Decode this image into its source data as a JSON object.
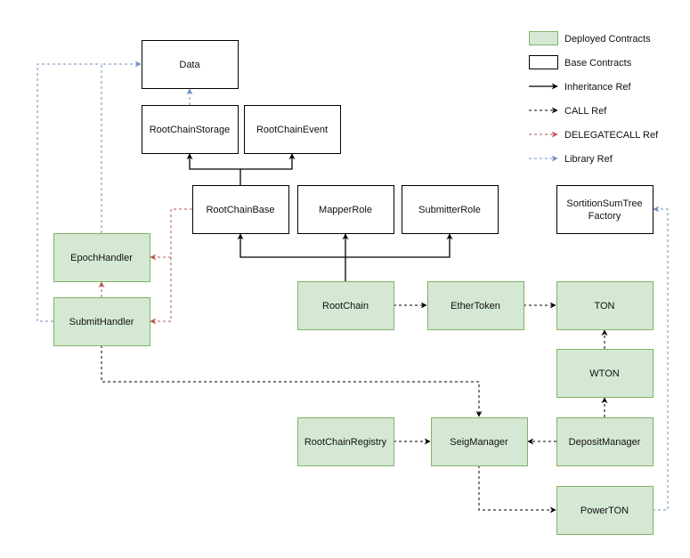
{
  "colors": {
    "deployed_fill": "#d5e8d4",
    "deployed_stroke": "#82b366",
    "base_fill": "#ffffff",
    "base_stroke": "#000000",
    "inheritance": "#000000",
    "call": "#000000",
    "delegatecall": "#b85450",
    "library": "#6c8ebf"
  },
  "legend": {
    "items": [
      {
        "kind": "deployed",
        "label": "Deployed Contracts"
      },
      {
        "kind": "base",
        "label": "Base Contracts"
      },
      {
        "kind": "inheritance",
        "label": "Inheritance Ref"
      },
      {
        "kind": "call",
        "label": "CALL Ref"
      },
      {
        "kind": "delegatecall",
        "label": "DELEGATECALL Ref"
      },
      {
        "kind": "library",
        "label": "Library Ref"
      }
    ]
  },
  "nodes": [
    {
      "id": "data",
      "lines": [
        "Data"
      ],
      "type": "base"
    },
    {
      "id": "rootchain-storage",
      "lines": [
        "RootChainStorage"
      ],
      "type": "base"
    },
    {
      "id": "rootchain-event",
      "lines": [
        "RootChainEvent"
      ],
      "type": "base"
    },
    {
      "id": "rootchain-base",
      "lines": [
        "RootChainBase"
      ],
      "type": "base"
    },
    {
      "id": "mapper-role",
      "lines": [
        "MapperRole"
      ],
      "type": "base"
    },
    {
      "id": "submitter-role",
      "lines": [
        "SubmitterRole"
      ],
      "type": "base"
    },
    {
      "id": "sortition-sum-tree-factory",
      "lines": [
        "SortitionSumTree",
        "Factory"
      ],
      "type": "base"
    },
    {
      "id": "epoch-handler",
      "lines": [
        "EpochHandler"
      ],
      "type": "deployed"
    },
    {
      "id": "submit-handler",
      "lines": [
        "SubmitHandler"
      ],
      "type": "deployed"
    },
    {
      "id": "rootchain",
      "lines": [
        "RootChain"
      ],
      "type": "deployed"
    },
    {
      "id": "ether-token",
      "lines": [
        "EtherToken"
      ],
      "type": "deployed"
    },
    {
      "id": "ton",
      "lines": [
        "TON"
      ],
      "type": "deployed"
    },
    {
      "id": "wton",
      "lines": [
        "WTON"
      ],
      "type": "deployed"
    },
    {
      "id": "rootchain-registry",
      "lines": [
        "RootChainRegistry"
      ],
      "type": "deployed"
    },
    {
      "id": "seig-manager",
      "lines": [
        "SeigManager"
      ],
      "type": "deployed"
    },
    {
      "id": "deposit-manager",
      "lines": [
        "DepositManager"
      ],
      "type": "deployed"
    },
    {
      "id": "power-ton",
      "lines": [
        "PowerTON"
      ],
      "type": "deployed"
    }
  ],
  "edges": [
    {
      "from": "rootchain-storage",
      "to": "data",
      "kind": "library"
    },
    {
      "from": "epoch-handler",
      "to": "data",
      "kind": "library"
    },
    {
      "from": "submit-handler",
      "to": "data",
      "kind": "library"
    },
    {
      "from": "rootchain-base",
      "to": "rootchain-storage",
      "kind": "inheritance"
    },
    {
      "from": "rootchain-base",
      "to": "rootchain-event",
      "kind": "inheritance"
    },
    {
      "from": "rootchain",
      "to": "rootchain-base",
      "kind": "inheritance"
    },
    {
      "from": "rootchain",
      "to": "mapper-role",
      "kind": "inheritance"
    },
    {
      "from": "rootchain",
      "to": "submitter-role",
      "kind": "inheritance"
    },
    {
      "from": "rootchain-base",
      "to": "epoch-handler",
      "kind": "delegatecall"
    },
    {
      "from": "rootchain-base",
      "to": "submit-handler",
      "kind": "delegatecall"
    },
    {
      "from": "submit-handler",
      "to": "epoch-handler",
      "kind": "delegatecall"
    },
    {
      "from": "rootchain",
      "to": "ether-token",
      "kind": "call"
    },
    {
      "from": "ether-token",
      "to": "ton",
      "kind": "call"
    },
    {
      "from": "wton",
      "to": "ton",
      "kind": "call"
    },
    {
      "from": "deposit-manager",
      "to": "wton",
      "kind": "call"
    },
    {
      "from": "submit-handler",
      "to": "seig-manager",
      "kind": "call"
    },
    {
      "from": "rootchain-registry",
      "to": "seig-manager",
      "kind": "call"
    },
    {
      "from": "deposit-manager",
      "to": "seig-manager",
      "kind": "call"
    },
    {
      "from": "seig-manager",
      "to": "power-ton",
      "kind": "call"
    },
    {
      "from": "power-ton",
      "to": "sortition-sum-tree-factory",
      "kind": "library"
    }
  ]
}
